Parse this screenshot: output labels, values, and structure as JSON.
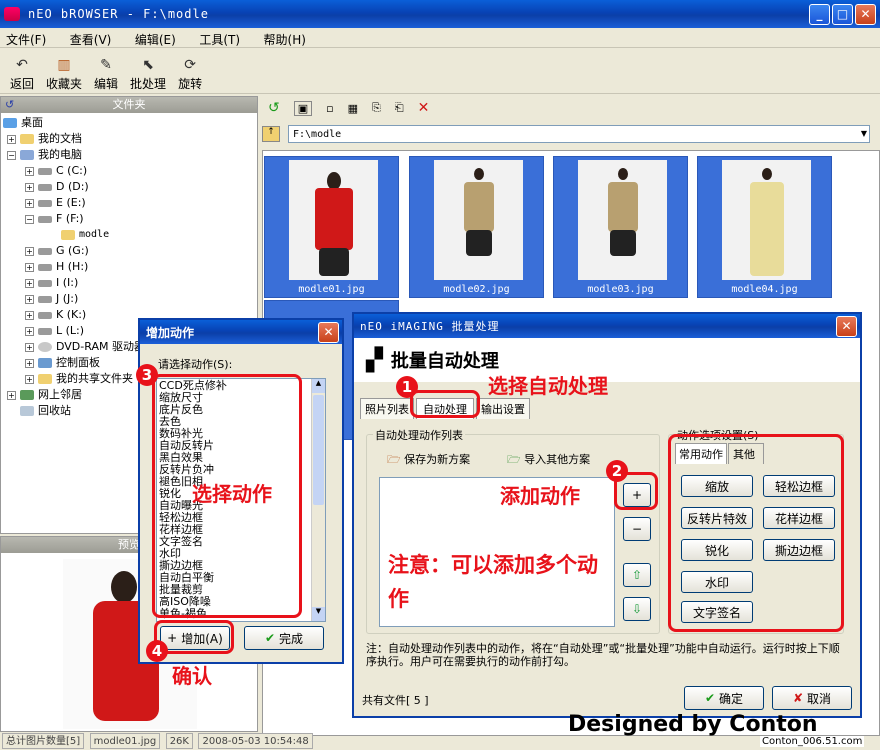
{
  "window": {
    "title": "nEO bROWSER - F:\\modle"
  },
  "menu": [
    "文件(F)",
    "查看(V)",
    "编辑(E)",
    "工具(T)",
    "帮助(H)"
  ],
  "toolbar": [
    {
      "label": "返回",
      "icon": "undo-icon"
    },
    {
      "label": "收藏夹",
      "icon": "bookmarks-icon"
    },
    {
      "label": "编辑",
      "icon": "edit-icon"
    },
    {
      "label": "批处理",
      "icon": "batch-icon"
    },
    {
      "label": "旋转",
      "icon": "rotate-icon"
    }
  ],
  "sidebar": {
    "header": "文件夹",
    "items": [
      "桌面",
      "我的文档",
      "我的电脑",
      "C (C:)",
      "D (D:)",
      "E (E:)",
      "F (F:)",
      "modle",
      "G (G:)",
      "H (H:)",
      "I (I:)",
      "J (J:)",
      "K (K:)",
      "L (L:)",
      "DVD-RAM 驱动器",
      "控制面板",
      "我的共享文件夹",
      "网上邻居",
      "回收站"
    ],
    "preview_header": "预览"
  },
  "address": {
    "path": "F:\\modle"
  },
  "thumbnails": [
    "modle01.jpg",
    "modle02.jpg",
    "modle03.jpg",
    "modle04.jpg"
  ],
  "status": {
    "count": "总计图片数量[5]",
    "file": "modle01.jpg",
    "size": "26K",
    "date": "2008-05-03 10:54:48"
  },
  "add_dialog": {
    "title": "增加动作",
    "prompt": "请选择动作(S):",
    "actions": [
      "CCD死点修补",
      "缩放尺寸",
      "底片反色",
      "去色",
      "数码补光",
      "自动反转片",
      "黑白效果",
      "反转片负冲",
      "褪色旧相",
      "锐化",
      "自动曝光",
      "轻松边框",
      "花样边框",
      "文字签名",
      "水印",
      "撕边边框",
      "自动白平衡",
      "批量裁剪",
      "高ISO降噪",
      "单色-褐色"
    ],
    "add_label": "增加(A)",
    "done_label": "完成"
  },
  "batch_dialog": {
    "title": "nEO iMAGING 批量处理",
    "heading": "批量自动处理",
    "tabs": [
      "照片列表",
      "自动处理",
      "输出设置"
    ],
    "list_group": "自动处理动作列表",
    "save_label": "保存为新方案",
    "import_label": "导入其他方案",
    "options_group": "动作选项设置(S)",
    "option_tabs": [
      "常用动作",
      "其他"
    ],
    "option_buttons": [
      "缩放",
      "轻松边框",
      "反转片特效",
      "花样边框",
      "锐化",
      "撕边边框",
      "水印",
      "文字签名"
    ],
    "note": "注：自动处理动作列表中的动作，将在“自动处理”或“批量处理”功能中自动运行。运行时按上下顺序执行。用户可在需要执行的动作前打勾。",
    "file_count": "共有文件[ 5 ]",
    "ok_label": "确定",
    "cancel_label": "取消"
  },
  "annotations": {
    "n1": "1",
    "n2": "2",
    "n3": "3",
    "n4": "4",
    "a1": "选择自动处理",
    "a2": "添加动作",
    "a3": "选择动作",
    "a4": "确认",
    "note": "注意：可以添加多个动作"
  },
  "footer": {
    "signature": "Designed by Conton",
    "watermark": "Conton_006.51.com"
  },
  "colors": {
    "annotation": "#e8121a",
    "selection": "#3a6fd8",
    "titlebar": "#0842b4"
  }
}
